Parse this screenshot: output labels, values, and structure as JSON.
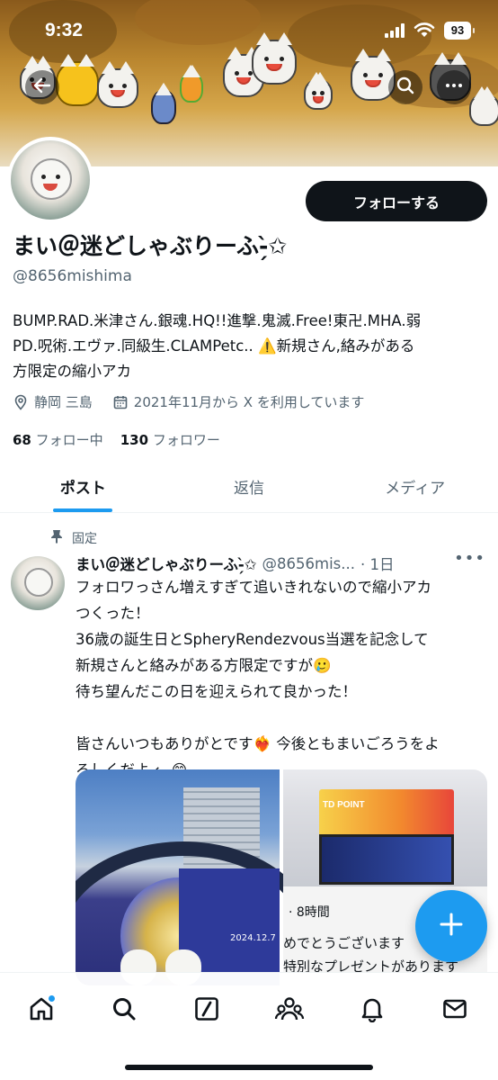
{
  "status_bar": {
    "time": "9:32",
    "battery": "93"
  },
  "profile": {
    "follow_label": "フォローする",
    "display_name": "まい＠迷どしゃぶりーふ-̗̀✩",
    "handle": "@8656mishima",
    "bio_lines": [
      "BUMP.RAD.米津さん.銀魂.HQ!!進撃.鬼滅.Free!東卍.MHA.弱",
      "PD.呪術.エヴァ.同級生.CLAMPetc.. ⚠️新規さん,絡みがある",
      "方限定の縮小アカ"
    ],
    "location": "静岡 三島",
    "joined": "2021年11月から X を利用しています",
    "following_count": "68",
    "following_label": "フォロー中",
    "followers_count": "130",
    "followers_label": "フォロワー"
  },
  "tabs": [
    {
      "label": "ポスト",
      "active": true
    },
    {
      "label": "返信",
      "active": false
    },
    {
      "label": "メディア",
      "active": false
    }
  ],
  "post": {
    "pinned_label": "固定",
    "author_name": "まい＠迷どしゃぶりーふ-̗̀✩",
    "author_handle": "@8656mis...",
    "time": "· 1日",
    "lines": [
      "フォロワっさん増えすぎて追いきれないので縮小アカ",
      "つくった！",
      "36歳の誕生日とSpheryRendezvous当選を記念して",
      "新規さんと絡みがある方限定ですが🥲",
      "待ち望んだこの日を迎えられて良かった！",
      "",
      "皆さんいつもありがとです❤️‍🔥 今後ともまいごろうをよ",
      "ろしくだよ ← 😊"
    ],
    "media_left_date": "2024.12.7",
    "media_right_sign": "TD POINT",
    "quoted_time": "· 8時間",
    "quoted_lines": [
      "めでとうございます",
      "特別なプレゼントがあります"
    ]
  },
  "icons": {
    "back": "arrow-left-icon",
    "search": "search-icon",
    "more": "more-icon",
    "compose": "plus-icon",
    "nav": [
      "home-icon",
      "search-icon",
      "grok-icon",
      "communities-icon",
      "bell-icon",
      "mail-icon"
    ]
  },
  "colors": {
    "accent": "#1d9bf0",
    "text": "#0f1419",
    "muted": "#536471"
  }
}
